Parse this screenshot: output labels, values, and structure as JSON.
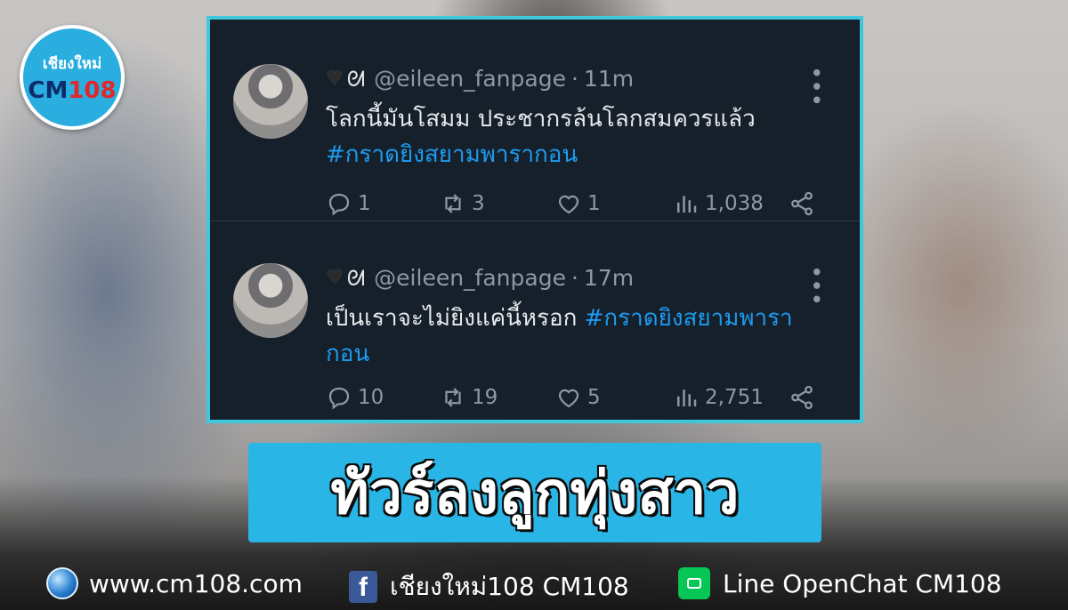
{
  "logo": {
    "top": "เชียงใหม่",
    "bottom_blue": "CM",
    "bottom_red": "108"
  },
  "tweets": [
    {
      "author_handle": "@eileen_fanpage",
      "time": "11m",
      "text": "โลกนี้มันโสมม ประชากรล้นโลกสมควรแล้ว",
      "hashtag": "#กราดยิงสยามพารากอน",
      "replies": "1",
      "retweets": "3",
      "likes": "1",
      "views": "1,038"
    },
    {
      "author_handle": "@eileen_fanpage",
      "time": "17m",
      "text": "เป็นเราจะไม่ยิงแค่นี้หรอก ",
      "hashtag": "#กราดยิงสยามพารากอน",
      "replies": "10",
      "retweets": "19",
      "likes": "5",
      "views": "2,751"
    }
  ],
  "caption": "ทัวร์ลงลูกทุ่งสาว",
  "footer": {
    "website": "www.cm108.com",
    "facebook": "เชียงใหม่108 CM108",
    "line": "Line OpenChat CM108"
  },
  "colors": {
    "panel_bg": "#15202b",
    "panel_border": "#3fc7dc",
    "hashtag": "#1d9bf0",
    "caption_bg": "#29b6e6"
  }
}
